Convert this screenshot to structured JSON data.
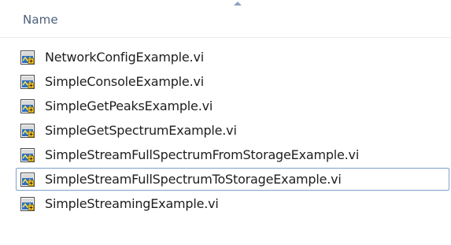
{
  "columns": {
    "name_label": "Name",
    "sort_direction": "ascending"
  },
  "files": [
    {
      "name": "NetworkConfigExample.vi",
      "icon": "labview-vi-icon",
      "focused": false
    },
    {
      "name": "SimpleConsoleExample.vi",
      "icon": "labview-vi-icon",
      "focused": false
    },
    {
      "name": "SimpleGetPeaksExample.vi",
      "icon": "labview-vi-icon",
      "focused": false
    },
    {
      "name": "SimpleGetSpectrumExample.vi",
      "icon": "labview-vi-icon",
      "focused": false
    },
    {
      "name": "SimpleStreamFullSpectrumFromStorageExample.vi",
      "icon": "labview-vi-icon",
      "focused": false
    },
    {
      "name": "SimpleStreamFullSpectrumToStorageExample.vi",
      "icon": "labview-vi-icon",
      "focused": true
    },
    {
      "name": "SimpleStreamingExample.vi",
      "icon": "labview-vi-icon",
      "focused": false
    }
  ],
  "colors": {
    "header_text": "#4c607a",
    "focus_border": "#7da2ce",
    "file_text": "#1e1e1e"
  }
}
